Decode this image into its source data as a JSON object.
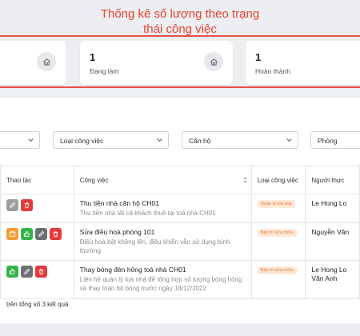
{
  "annotation": {
    "line1": "Thống kê số lượng theo trạng",
    "line2": "thái công việc"
  },
  "stats": [
    {
      "count": "",
      "label": ""
    },
    {
      "count": "1",
      "label": "Đang làm"
    },
    {
      "count": "1",
      "label": "Hoàn thành"
    }
  ],
  "filters": {
    "first": "",
    "task_type": "Loại công việc",
    "apartment": "Căn hộ",
    "room": "Phòng"
  },
  "table": {
    "headers": {
      "actions": "Thao tác",
      "task": "Công việc",
      "task_type": "Loại công việc",
      "assignee": "Người thực"
    },
    "rows": [
      {
        "title": "Thu tiền nhà căn hộ CH01",
        "desc": "Thu tiền nhà tất cả khách thuê tại toà nhà CH01",
        "badge": "Quản lý toà nhà",
        "person_line1": "Le Hong Lo",
        "person_line2": ""
      },
      {
        "title": "Sửa điều hoà phòng 101",
        "desc": "Điều hoà bật không lên, điều khiển vẫn sử dụng bình thường.",
        "badge": "Bảo trì sửa chữa",
        "person_line1": "Nguyễn Văn",
        "person_line2": ""
      },
      {
        "title": "Thay bóng đèn hỏng toà nhà CH01",
        "desc": "Liên hệ quản lý toà nhà để tổng hợp số lượng bóng hỏng và thay toàn bộ bóng trước ngày 18/12/2022",
        "badge": "Bảo trì sửa chữa",
        "person_line1": "Le Hong Lo",
        "person_line2": "Văn Anh"
      }
    ]
  },
  "footer": {
    "summary": "trên tổng số 3 kết quả"
  },
  "colors": {
    "accent_annotation": "#e8412f",
    "badge_bg": "#fde8d8",
    "badge_text": "#e8742f",
    "btn_red": "#e23b3b",
    "btn_green": "#33b44a",
    "btn_orange": "#f39c33",
    "btn_grey": "#9e9e9e"
  },
  "icons": {
    "stat": "home-icon",
    "row_actions": [
      "view-icon",
      "delete-icon",
      "thumbs-up-icon",
      "edit-icon",
      "box-icon"
    ]
  }
}
